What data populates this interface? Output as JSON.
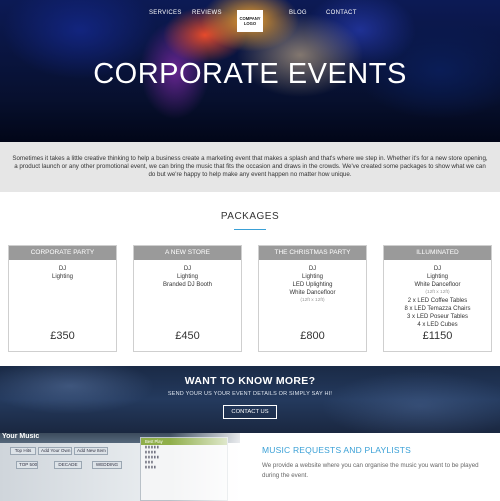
{
  "nav": {
    "items": [
      "SERVICES",
      "REVIEWS",
      "BLOG",
      "CONTACT"
    ],
    "logo": "COMPANY LOGO"
  },
  "hero": {
    "title": "CORPORATE EVENTS"
  },
  "intro": {
    "text": "Sometimes it takes a little creative thinking to help a business create a marketing event that makes a splash and that's where we step in. Whether it's for a new store opening, a product launch or any other promotional event, we can bring the music that fits the occasion and draws in the crowds. We've created some packages to show what we can do but we're happy to help make any event happen no matter how unique."
  },
  "packages": {
    "title": "PACKAGES",
    "cards": [
      {
        "name": "CORPORATE PARTY",
        "items": [
          "DJ",
          "Lighting"
        ],
        "note": "",
        "extra": [],
        "price": "£350"
      },
      {
        "name": "A NEW STORE",
        "items": [
          "DJ",
          "Lighting",
          "Branded DJ Booth"
        ],
        "note": "",
        "extra": [],
        "price": "£450"
      },
      {
        "name": "THE CHRISTMAS PARTY",
        "items": [
          "DJ",
          "Lighting",
          "LED Uplighting",
          "White Dancefloor"
        ],
        "note": "(12ft x 12ft)",
        "extra": [],
        "price": "£800"
      },
      {
        "name": "ILLUMINATED",
        "items": [
          "DJ",
          "Lighting",
          "White Dancefloor"
        ],
        "note": "(12ft x 12ft)",
        "extra": [
          "2 x LED Coffee Tables",
          "8 x LED Temazza Chairs",
          "3 x LED Poseur Tables",
          "4 x LED Cubes"
        ],
        "price": "£1150"
      }
    ]
  },
  "cta": {
    "title": "WANT TO KNOW MORE?",
    "subtitle": "SEND YOUR US YOUR EVENT DETAILS OR SIMPLY SAY HI!",
    "button": "CONTACT US"
  },
  "music": {
    "title": "MUSIC REQUESTS AND PLAYLISTS",
    "text": "We provide a website where you can organise the music you want to be played during the event.",
    "app_title": "Your Music",
    "app_tabs": [
      "Top Hits",
      "Add Your Own",
      "Add New Item",
      "TOP 500",
      "DECADE",
      "WEDDING"
    ],
    "panel_head": "Best Play"
  }
}
